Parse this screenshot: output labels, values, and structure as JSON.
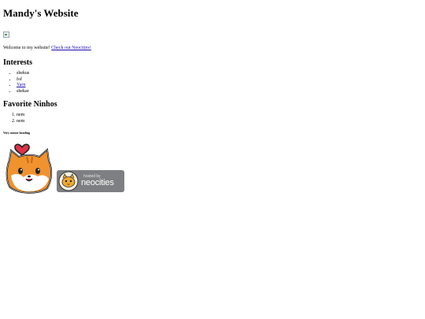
{
  "header": {
    "title": "Mandy's Website"
  },
  "intro": {
    "text": "Welcome to my website! ",
    "link": "Check out Neocities!"
  },
  "interests": {
    "heading": "Interests",
    "items": [
      "shekus",
      "fof",
      "Yarn",
      "shekar"
    ]
  },
  "ninhos": {
    "heading": "Favorite Ninhos",
    "items": [
      "nem",
      "nem"
    ]
  },
  "minor": {
    "heading": "Very minor heading"
  },
  "badge": {
    "small_text": "hosted by",
    "big_text": "neocities"
  },
  "colors": {
    "link": "#1a0dab",
    "cat_orange": "#f0922e",
    "badge_gray": "#7d7f82"
  },
  "icons": [
    "broken-image-icon",
    "cat-heart-icon",
    "neocities-cat-icon"
  ]
}
